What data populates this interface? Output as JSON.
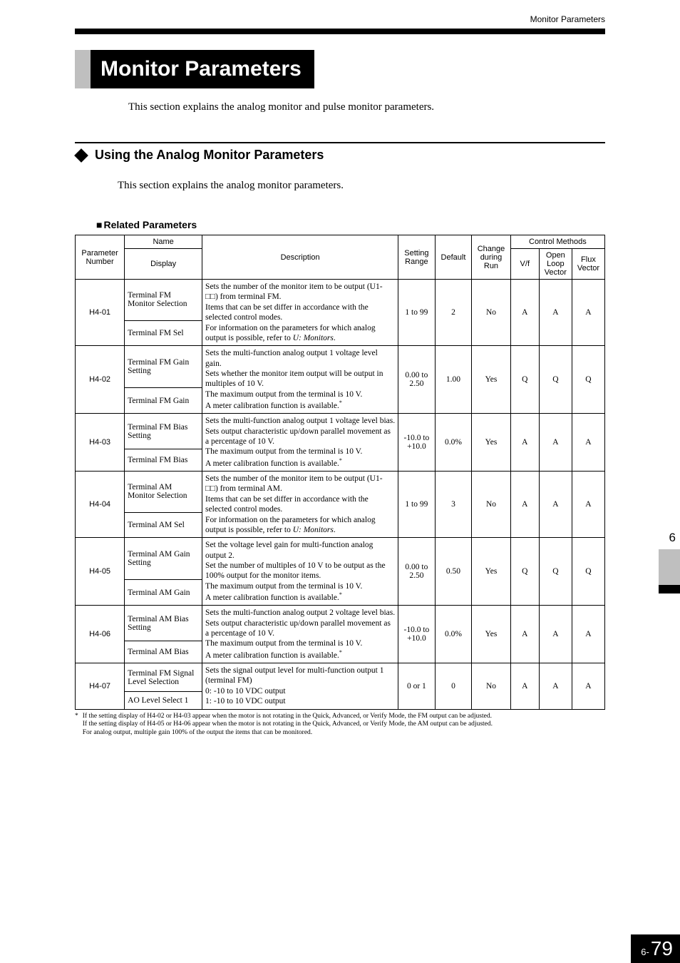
{
  "header": {
    "right": "Monitor Parameters"
  },
  "title": "Monitor Parameters",
  "intro": "This section explains the analog monitor and pulse monitor parameters.",
  "section": {
    "heading": "Using the Analog Monitor Parameters",
    "intro": "This section explains the analog monitor parameters.",
    "subhead": "Related Parameters"
  },
  "table": {
    "headers": {
      "param_no": "Parameter Number",
      "name": "Name",
      "display": "Display",
      "description": "Description",
      "setting_range": "Setting Range",
      "default": "Default",
      "change": "Change during Run",
      "control_methods": "Control Methods",
      "vf": "V/f",
      "olv": "Open Loop Vector",
      "fv": "Flux Vector"
    },
    "rows": [
      {
        "num": "H4-01",
        "name": "Terminal FM Monitor Selection",
        "display": "Terminal FM Sel",
        "desc": "Sets the number of the monitor item to be output (U1-□□) from terminal FM.\nItems that can be set differ in accordance with the selected control modes.\nFor information on the parameters for which analog output is possible, refer to ",
        "desc_ital": "U: Monitors",
        "desc_tail": ".",
        "range": "1 to 99",
        "default": "2",
        "change": "No",
        "vf": "A",
        "olv": "A",
        "fv": "A"
      },
      {
        "num": "H4-02",
        "name": "Terminal FM Gain Setting",
        "display": "Terminal FM Gain",
        "desc": "Sets the multi-function analog output 1 voltage level gain.\nSets whether the monitor item output will be output in multiples of 10 V.\nThe maximum output from the terminal is 10 V.\nA meter calibration function is available.",
        "sup": "*",
        "range": "0.00 to 2.50",
        "default": "1.00",
        "change": "Yes",
        "vf": "Q",
        "olv": "Q",
        "fv": "Q"
      },
      {
        "num": "H4-03",
        "name": "Terminal FM Bias Setting",
        "display": "Terminal FM Bias",
        "desc": "Sets the multi-function analog output 1 voltage level bias.\nSets output characteristic up/down parallel movement as a percentage of 10 V.\nThe maximum output from the terminal is 10 V.\nA meter calibration function is available.",
        "sup": "*",
        "range": "-10.0 to +10.0",
        "default": "0.0%",
        "change": "Yes",
        "vf": "A",
        "olv": "A",
        "fv": "A"
      },
      {
        "num": "H4-04",
        "name": "Terminal AM Monitor Selection",
        "display": "Terminal AM Sel",
        "desc": "Sets the number of the monitor item to be output (U1-□□) from terminal AM.\nItems that can be set differ in accordance with the selected control modes.\nFor information on the parameters for which analog output is possible, refer to ",
        "desc_ital": "U: Monitors",
        "desc_tail": ".",
        "range": "1 to 99",
        "default": "3",
        "change": "No",
        "vf": "A",
        "olv": "A",
        "fv": "A"
      },
      {
        "num": "H4-05",
        "name": "Terminal AM Gain Setting",
        "display": "Terminal AM Gain",
        "desc": "Set the voltage level gain for multi-function analog output 2.\nSet the number of multiples of 10 V to be output as the 100% output for the monitor items.\nThe maximum output from the terminal is 10 V.\nA meter calibration function is available.",
        "sup": "*",
        "range": "0.00 to 2.50",
        "default": "0.50",
        "change": "Yes",
        "vf": "Q",
        "olv": "Q",
        "fv": "Q"
      },
      {
        "num": "H4-06",
        "name": "Terminal AM Bias Setting",
        "display": "Terminal AM Bias",
        "desc": "Sets the multi-function analog output 2 voltage level bias.\nSets output characteristic up/down parallel movement as a percentage of 10 V.\nThe maximum output from the terminal is 10 V.\nA meter calibration function is available.",
        "sup": "*",
        "range": "-10.0 to +10.0",
        "default": "0.0%",
        "change": "Yes",
        "vf": "A",
        "olv": "A",
        "fv": "A"
      },
      {
        "num": "H4-07",
        "name": "Terminal FM Signal Level Selection",
        "display": "AO Level Select 1",
        "desc": "Sets the signal output level for multi-function output 1 (terminal FM)\n0:  -10 to 10 VDC output\n1:  -10 to 10 VDC output",
        "range": "0 or 1",
        "default": "0",
        "change": "No",
        "vf": "A",
        "olv": "A",
        "fv": "A"
      }
    ]
  },
  "footnote": {
    "mark": "*",
    "text": "If the setting display of H4-02 or H4-03 appear when the motor is not rotating in the Quick, Advanced, or Verify Mode, the FM output can be adjusted.\nIf the setting display of H4-05 or H4-06 appear when the motor is not rotating in the Quick, Advanced, or Verify Mode, the AM output can be adjusted.\nFor analog output, multiple gain 100% of the output the items that can be monitored."
  },
  "sidebar": {
    "chapter": "6"
  },
  "footer": {
    "prefix": "6-",
    "page": "79"
  }
}
